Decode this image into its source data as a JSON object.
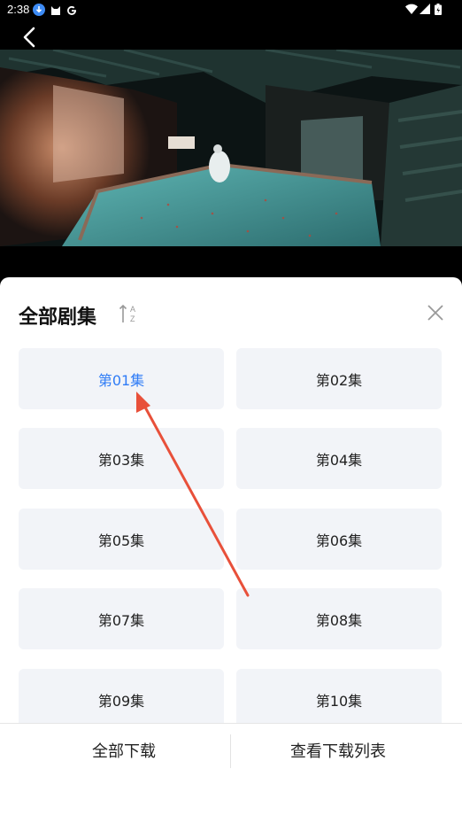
{
  "status_bar": {
    "time": "2:38"
  },
  "sheet": {
    "title": "全部剧集",
    "episodes": [
      {
        "label": "第01集",
        "selected": true
      },
      {
        "label": "第02集",
        "selected": false
      },
      {
        "label": "第03集",
        "selected": false
      },
      {
        "label": "第04集",
        "selected": false
      },
      {
        "label": "第05集",
        "selected": false
      },
      {
        "label": "第06集",
        "selected": false
      },
      {
        "label": "第07集",
        "selected": false
      },
      {
        "label": "第08集",
        "selected": false
      },
      {
        "label": "第09集",
        "selected": false
      },
      {
        "label": "第10集",
        "selected": false
      }
    ]
  },
  "footer": {
    "download_all": "全部下载",
    "view_downloads": "查看下载列表"
  },
  "colors": {
    "accent": "#2f7cf6",
    "annotation_arrow": "#e8503a",
    "tile_bg": "#f2f4f8"
  }
}
